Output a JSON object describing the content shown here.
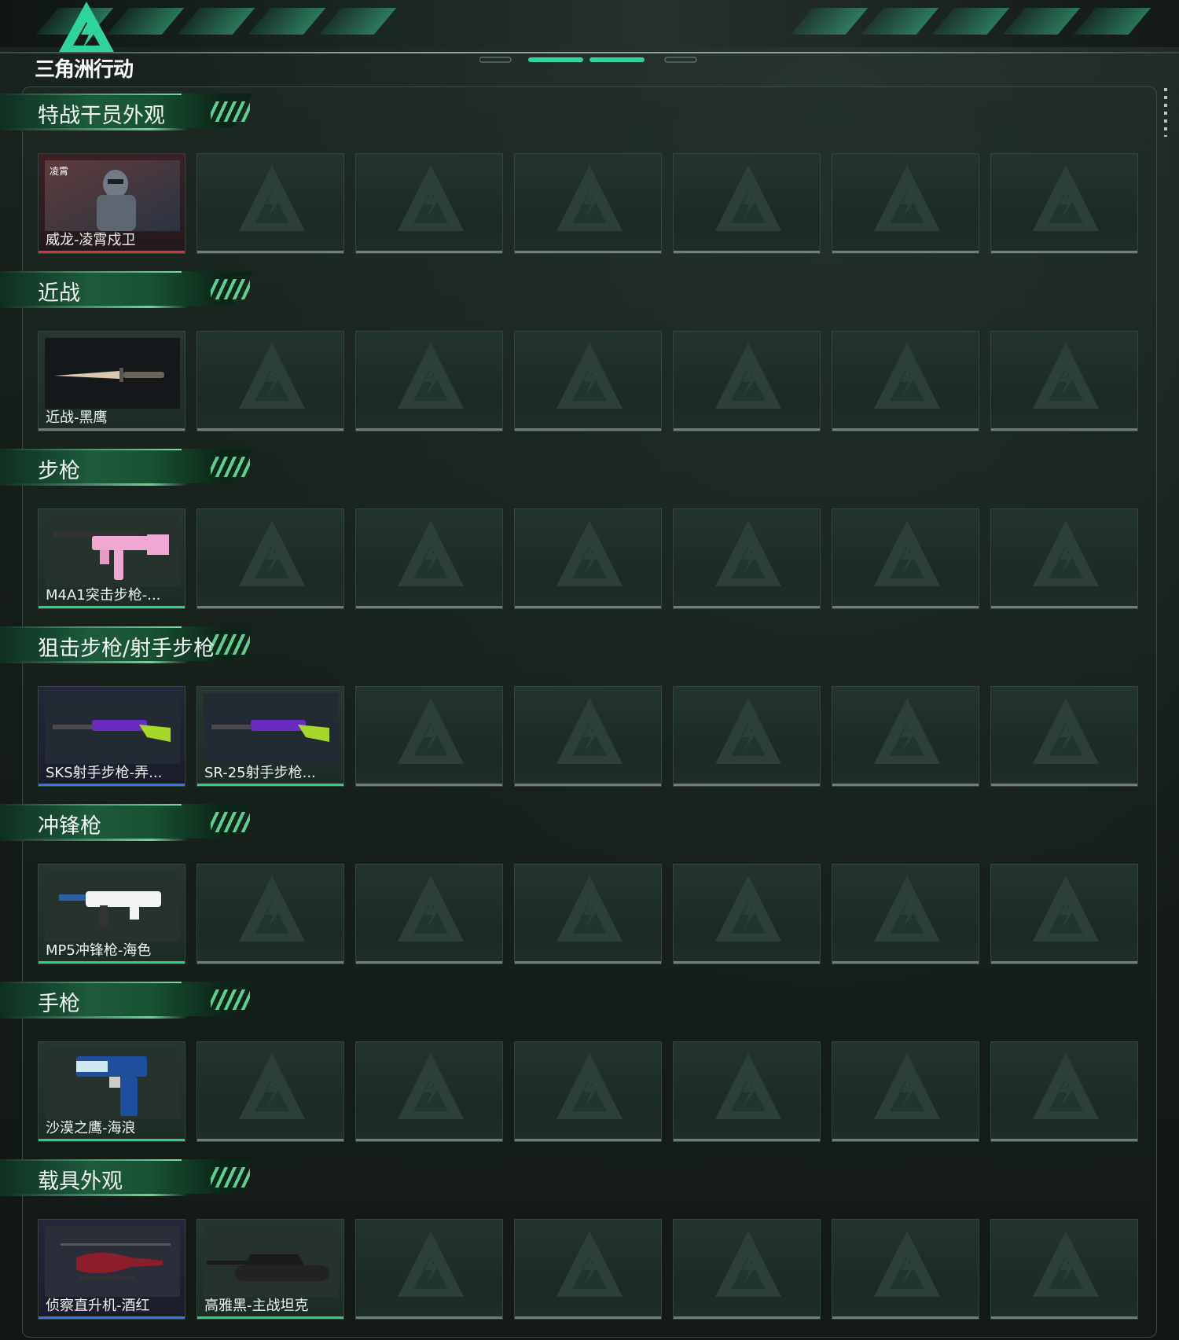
{
  "app": {
    "logo_text": "三角洲行动"
  },
  "colors": {
    "accent_green": "#2fd07b",
    "quality_red": "#d33535",
    "quality_green": "#2fd07b",
    "quality_blue": "#2f7ae0"
  },
  "sections": [
    {
      "title": "特战干员外观",
      "items": [
        {
          "label": "威龙-凌霄戍卫",
          "quality": "red",
          "icon": "operator-portrait-thumbnail"
        }
      ]
    },
    {
      "title": "近战",
      "items": [
        {
          "label": "近战-黑鹰",
          "quality": "grey",
          "icon": "knife-thumbnail"
        }
      ]
    },
    {
      "title": "步枪",
      "items": [
        {
          "label": "M4A1突击步枪-...",
          "quality": "green",
          "icon": "assault-rifle-thumbnail"
        }
      ]
    },
    {
      "title": "狙击步枪/射手步枪",
      "items": [
        {
          "label": "SKS射手步枪-弄...",
          "quality": "blue",
          "icon": "marksman-rifle-thumbnail"
        },
        {
          "label": "SR-25射手步枪...",
          "quality": "green",
          "icon": "marksman-rifle-thumbnail"
        }
      ]
    },
    {
      "title": "冲锋枪",
      "items": [
        {
          "label": "MP5冲锋枪-海色",
          "quality": "green",
          "icon": "smg-thumbnail"
        }
      ]
    },
    {
      "title": "手枪",
      "items": [
        {
          "label": "沙漠之鹰-海浪",
          "quality": "green",
          "icon": "pistol-thumbnail"
        }
      ]
    },
    {
      "title": "载具外观",
      "items": [
        {
          "label": "侦察直升机-酒红",
          "quality": "blue",
          "icon": "helicopter-thumbnail"
        },
        {
          "label": "高雅黑-主战坦克",
          "quality": "green",
          "icon": "tank-thumbnail"
        }
      ]
    }
  ]
}
